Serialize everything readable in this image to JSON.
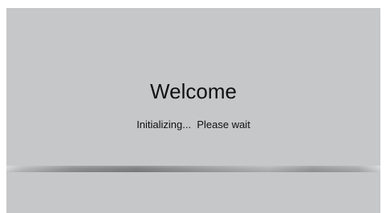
{
  "splash": {
    "title": "Welcome",
    "status_text": "Initializing...  Please wait"
  },
  "colors": {
    "panel_background": "#c6c7c9",
    "text": "#111111",
    "progress_dark": "#7f8082",
    "progress_light": "#d3d4d6"
  }
}
